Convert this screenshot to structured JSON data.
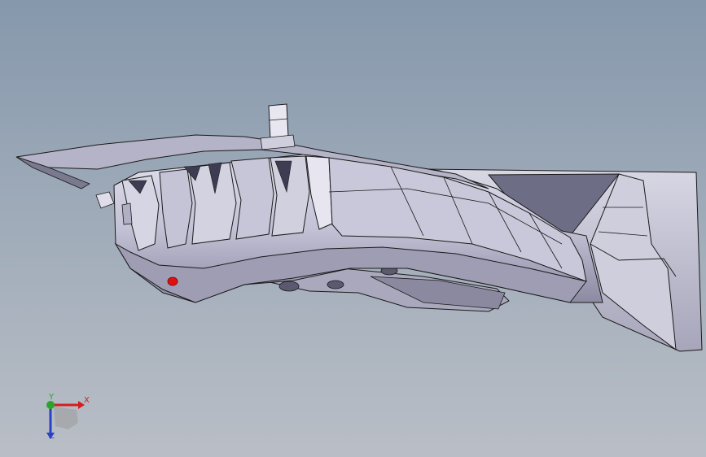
{
  "viewport": {
    "background_top": "#8698ac",
    "background_bottom": "#b9bec6"
  },
  "model": {
    "body_color": "#c7c6d8",
    "shadow_color": "#6a6a82",
    "edge_color": "#1a1a1a",
    "marker_color": "#e01010"
  },
  "triad": {
    "x_label": "X",
    "y_label": "Y",
    "z_label": "Z",
    "x_color": "#d41e1e",
    "y_color": "#2aa52a",
    "z_color": "#2a40c8",
    "icon": "coordinate-triad-icon"
  }
}
